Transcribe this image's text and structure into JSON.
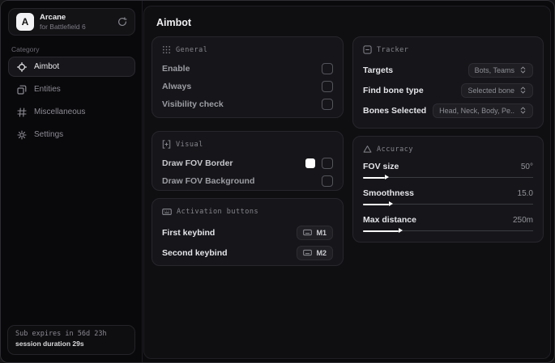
{
  "sidebar": {
    "brand": {
      "logo_letter": "A",
      "name": "Arcane",
      "subtitle": "for Battlefield 6",
      "action_icon": "refresh"
    },
    "category_label": "Category",
    "items": [
      {
        "label": "Aimbot",
        "icon": "crosshair",
        "active": true
      },
      {
        "label": "Entities",
        "icon": "layers",
        "active": false
      },
      {
        "label": "Miscellaneous",
        "icon": "hash-grid",
        "active": false
      },
      {
        "label": "Settings",
        "icon": "gear",
        "active": false
      }
    ],
    "status": {
      "line1": "Sub expires in 56d 23h",
      "line2": "session duration 29s"
    }
  },
  "main": {
    "title": "Aimbot",
    "general": {
      "title": "General",
      "icon": "grid-dots",
      "rows": [
        {
          "label": "Enable",
          "checked": false
        },
        {
          "label": "Always",
          "checked": false
        },
        {
          "label": "Visibility check",
          "checked": false
        }
      ]
    },
    "visual": {
      "title": "Visual",
      "icon": "scan-plus",
      "rows": [
        {
          "label": "Draw FOV Border",
          "swatch": "#ffffff",
          "checked": false
        },
        {
          "label": "Draw FOV Background",
          "checked": false
        }
      ]
    },
    "activation": {
      "title": "Activation buttons",
      "icon": "keyboard",
      "rows": [
        {
          "label": "First keybind",
          "key": "M1"
        },
        {
          "label": "Second keybind",
          "key": "M2"
        }
      ]
    },
    "tracker": {
      "title": "Tracker",
      "icon": "panel-minus",
      "rows": [
        {
          "label": "Targets",
          "value": "Bots, Teams"
        },
        {
          "label": "Find bone type",
          "value": "Selected bone"
        },
        {
          "label": "Bones Selected",
          "value": "Head, Neck, Body, Pe.."
        }
      ]
    },
    "accuracy": {
      "title": "Accuracy",
      "icon": "triangle",
      "sliders": [
        {
          "label": "FOV size",
          "value": "50°",
          "fill_pct": 13
        },
        {
          "label": "Smoothness",
          "value": "15.0",
          "fill_pct": 15
        },
        {
          "label": "Max distance",
          "value": "250m",
          "fill_pct": 21
        }
      ]
    }
  },
  "colors": {
    "window_bg": "#0a0a0c",
    "card_bg": "#16161a",
    "accent_fill": "#ffffff",
    "fov_border_swatch": "#ffffff",
    "text_primary": "#e5e6e9",
    "text_muted": "#8e8f96"
  }
}
